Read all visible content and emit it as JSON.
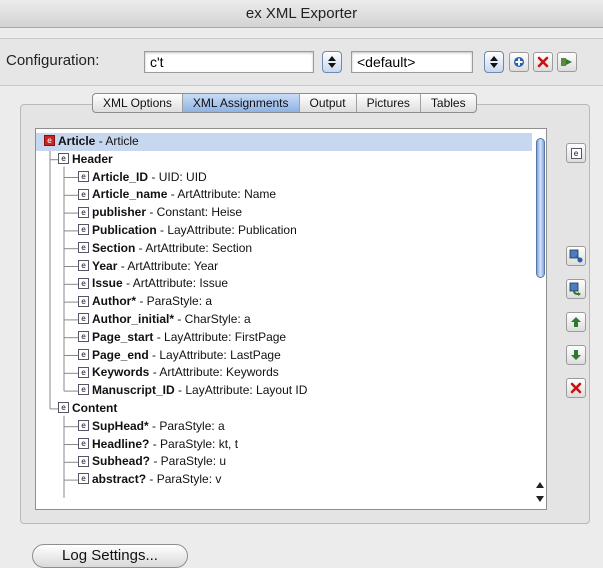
{
  "window": {
    "title": "ex XML Exporter"
  },
  "config": {
    "label": "Configuration:",
    "value": "c't",
    "default_value": "<default>",
    "stepper_icon": "stepper-arrows",
    "add_icon": "plus-icon",
    "delete_icon": "x-icon",
    "export_icon": "export-icon"
  },
  "tabs": [
    {
      "label": "XML Options"
    },
    {
      "label": "XML Assignments",
      "active": true
    },
    {
      "label": "Output"
    },
    {
      "label": "Pictures"
    },
    {
      "label": "Tables"
    }
  ],
  "tree": [
    {
      "name": "Article",
      "desc": " - Article",
      "level": 0,
      "selected": true
    },
    {
      "name": "Header",
      "desc": "",
      "level": 1
    },
    {
      "name": "Article_ID",
      "desc": " - UID: UID",
      "level": 2
    },
    {
      "name": "Article_name",
      "desc": " - ArtAttribute: Name",
      "level": 2
    },
    {
      "name": "publisher",
      "desc": " - Constant: Heise",
      "level": 2
    },
    {
      "name": "Publication",
      "desc": " - LayAttribute: Publication",
      "level": 2
    },
    {
      "name": "Section",
      "desc": " - ArtAttribute: Section",
      "level": 2
    },
    {
      "name": "Year",
      "desc": " - ArtAttribute: Year",
      "level": 2
    },
    {
      "name": "Issue",
      "desc": " - ArtAttribute: Issue",
      "level": 2
    },
    {
      "name": "Author*",
      "desc": " - ParaStyle: a",
      "level": 2
    },
    {
      "name": "Author_initial*",
      "desc": " - CharStyle: a",
      "level": 2
    },
    {
      "name": "Page_start",
      "desc": " - LayAttribute: FirstPage",
      "level": 2
    },
    {
      "name": "Page_end",
      "desc": " - LayAttribute: LastPage",
      "level": 2
    },
    {
      "name": "Keywords",
      "desc": " - ArtAttribute: Keywords",
      "level": 2
    },
    {
      "name": "Manuscript_ID",
      "desc": " - LayAttribute: Layout ID",
      "level": 2
    },
    {
      "name": "Content",
      "desc": "",
      "level": 1
    },
    {
      "name": "SupHead*",
      "desc": " - ParaStyle: a",
      "level": 2
    },
    {
      "name": "Headline?",
      "desc": " - ParaStyle: kt, t",
      "level": 2
    },
    {
      "name": "Subhead?",
      "desc": " - ParaStyle: u",
      "level": 2
    },
    {
      "name": "abstract?",
      "desc": " - ParaStyle: v",
      "level": 2
    }
  ],
  "side_buttons": [
    {
      "name": "element-icon-button",
      "icon": "element-icon"
    },
    {
      "name": "add-child-button",
      "icon": "add-child-icon"
    },
    {
      "name": "add-sibling-button",
      "icon": "add-sibling-icon"
    },
    {
      "name": "move-up-button",
      "icon": "arrow-up-icon"
    },
    {
      "name": "move-down-button",
      "icon": "arrow-down-icon"
    },
    {
      "name": "delete-element-button",
      "icon": "x-icon"
    }
  ],
  "log_button": {
    "label": "Log Settings..."
  },
  "colors": {
    "selection": "#c7d7ef",
    "accent_blue": "#7ea6e0",
    "delete_red": "#cc1111",
    "move_green": "#2f7a2f"
  }
}
